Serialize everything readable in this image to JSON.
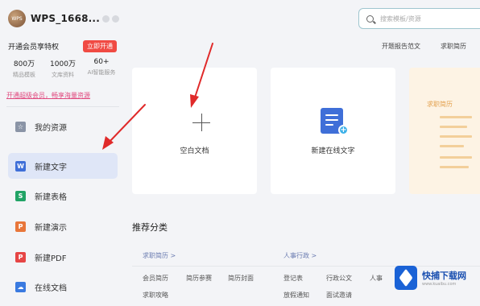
{
  "user": {
    "name": "WPS_1668...",
    "avatar_text": "WPS"
  },
  "vip": {
    "text": "开通会员享特权",
    "button": "立即开通"
  },
  "stats": [
    {
      "value": "800万",
      "label": "精品模板"
    },
    {
      "value": "1000万",
      "label": "文库资料"
    },
    {
      "value": "60+",
      "label": "AI智能服务"
    }
  ],
  "promo_link": "开通超级会员，畅享海量资源",
  "nav": [
    {
      "label": "我的资源",
      "icon": "resource-icon",
      "color": "#8a94a6",
      "glyph": "☆"
    },
    {
      "label": "新建文字",
      "icon": "word-icon",
      "color": "#3f6fd8",
      "glyph": "W"
    },
    {
      "label": "新建表格",
      "icon": "sheet-icon",
      "color": "#21a366",
      "glyph": "S"
    },
    {
      "label": "新建演示",
      "icon": "slides-icon",
      "color": "#e8763a",
      "glyph": "P"
    },
    {
      "label": "新建PDF",
      "icon": "pdf-icon",
      "color": "#e64545",
      "glyph": "P"
    },
    {
      "label": "在线文档",
      "icon": "cloud-doc-icon",
      "color": "#3a7ae0",
      "glyph": "☁"
    }
  ],
  "search": {
    "placeholder": "搜索模板/资源"
  },
  "top_links": [
    "开题报告范文",
    "求职简历"
  ],
  "cards": {
    "blank": "空白文档",
    "online": "新建在线文字",
    "resume": "求职简历"
  },
  "recommend": {
    "title": "推荐分类",
    "columns": [
      {
        "head": "求职简历 >",
        "items": [
          "会员简历",
          "简历参赛",
          "简历封面",
          "求职攻略"
        ]
      },
      {
        "head": "人事行政 >",
        "items": [
          "登记表",
          "行政公文",
          "人事",
          "放假通知",
          "面试邀请"
        ]
      }
    ]
  },
  "watermark": {
    "text": "快捕下载网",
    "sub": "www.kuaibu.com"
  },
  "colors": {
    "accent": "#3f6fd8",
    "vip_red": "#f04a43",
    "arrow": "#e02a2a"
  }
}
